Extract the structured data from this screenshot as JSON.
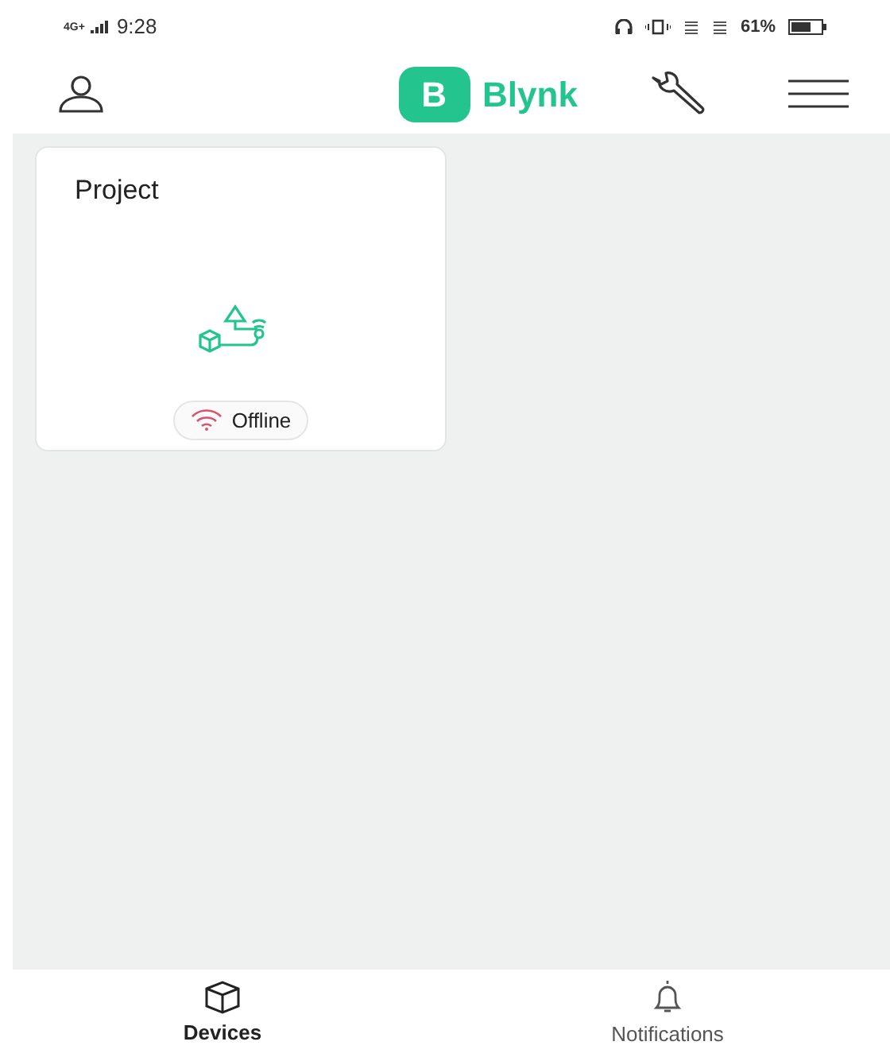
{
  "status_bar": {
    "network": "4G+",
    "time": "9:28",
    "battery": "61%"
  },
  "header": {
    "logo_letter": "B",
    "logo_text": "Blynk"
  },
  "devices": [
    {
      "name": "Project",
      "online": false,
      "status": "Offline"
    }
  ],
  "tabs": [
    {
      "label": "Devices",
      "selected": true
    },
    {
      "label": "Notifications",
      "selected": false
    }
  ]
}
